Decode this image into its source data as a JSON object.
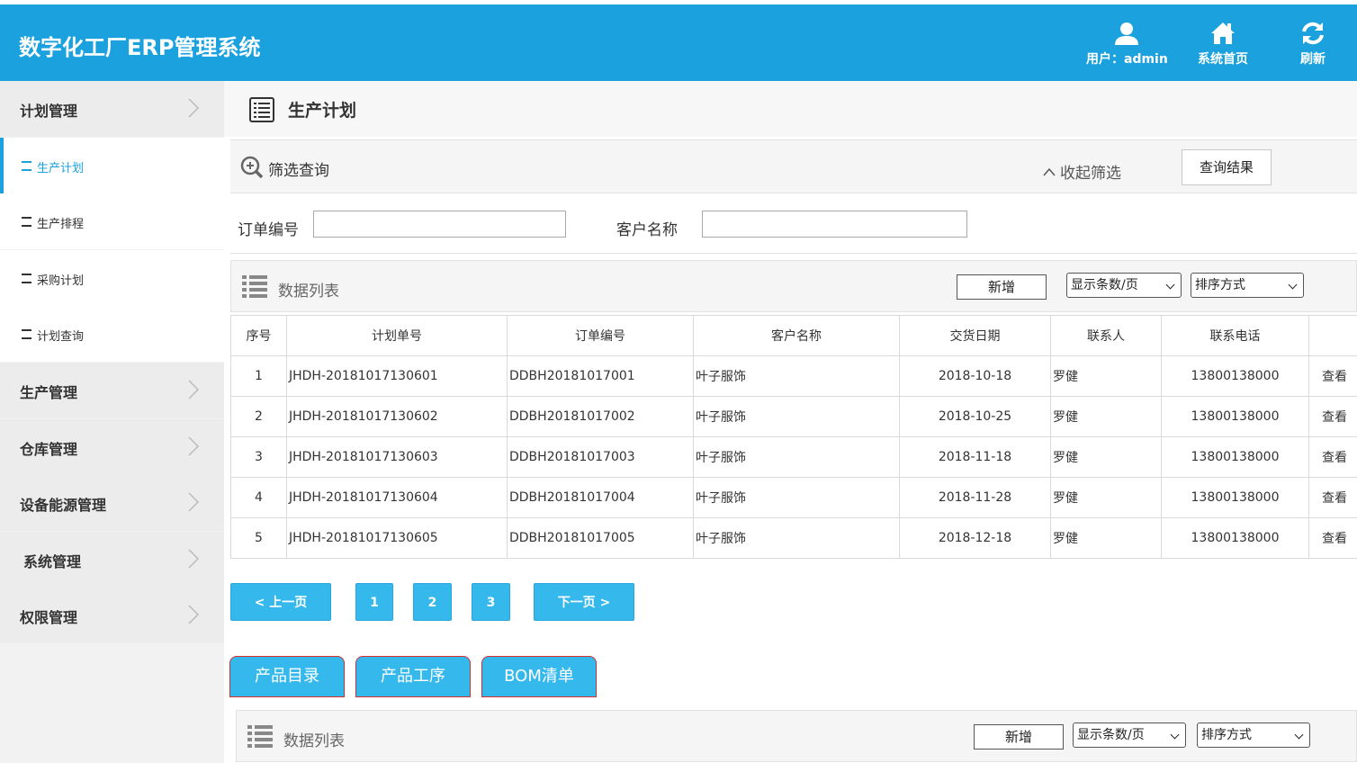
{
  "header": {
    "app_title": "数字化工厂ERP管理系统",
    "user_label": "用户：admin",
    "home_label": "系统首页",
    "refresh_label": "刷新",
    "bg_color": "#1aa1de"
  },
  "sidebar": {
    "groups": [
      {
        "label": "计划管理"
      },
      {
        "label": "生产管理"
      },
      {
        "label": "仓库管理"
      },
      {
        "label": "设备能源管理"
      },
      {
        "label": "系统管理"
      },
      {
        "label": "权限管理"
      }
    ],
    "sub_items": [
      {
        "label": "生产计划",
        "active": true
      },
      {
        "label": "生产排程"
      },
      {
        "label": "采购计划"
      },
      {
        "label": "计划查询"
      }
    ]
  },
  "page": {
    "title": "生产计划"
  },
  "filter": {
    "label": "筛选查询",
    "collapse_label": "收起筛选",
    "query_button": "查询结果",
    "order_no_label": "订单编号",
    "order_no_value": "",
    "customer_label": "客户名称",
    "customer_value": ""
  },
  "list1": {
    "label": "数据列表",
    "add_button": "新增",
    "page_size_select": "显示条数/页",
    "sort_select": "排序方式"
  },
  "table": {
    "headers": [
      "序号",
      "计划单号",
      "订单编号",
      "客户名称",
      "交货日期",
      "联系人",
      "联系电话",
      ""
    ],
    "rows": [
      {
        "no": "1",
        "plan_no": "JHDH-20181017130601",
        "order_no": "DDBH20181017001",
        "customer": "叶子服饰",
        "date": "2018-10-18",
        "contact": "罗健",
        "phone": "13800138000",
        "action": "查看"
      },
      {
        "no": "2",
        "plan_no": "JHDH-20181017130602",
        "order_no": "DDBH20181017002",
        "customer": "叶子服饰",
        "date": "2018-10-25",
        "contact": "罗健",
        "phone": "13800138000",
        "action": "查看"
      },
      {
        "no": "3",
        "plan_no": "JHDH-20181017130603",
        "order_no": "DDBH20181017003",
        "customer": "叶子服饰",
        "date": "2018-11-18",
        "contact": "罗健",
        "phone": "13800138000",
        "action": "查看"
      },
      {
        "no": "4",
        "plan_no": "JHDH-20181017130604",
        "order_no": "DDBH20181017004",
        "customer": "叶子服饰",
        "date": "2018-11-28",
        "contact": "罗健",
        "phone": "13800138000",
        "action": "查看"
      },
      {
        "no": "5",
        "plan_no": "JHDH-20181017130605",
        "order_no": "DDBH20181017005",
        "customer": "叶子服饰",
        "date": "2018-12-18",
        "contact": "罗健",
        "phone": "13800138000",
        "action": "查看"
      }
    ]
  },
  "pager": {
    "prev": "< 上一页",
    "pages": [
      "1",
      "2",
      "3"
    ],
    "next": "下一页 >"
  },
  "tabs": [
    "产品目录",
    "产品工序",
    "BOM清单"
  ],
  "list2": {
    "label": "数据列表",
    "add_button": "新增",
    "page_size_select": "显示条数/页",
    "sort_select": "排序方式"
  }
}
